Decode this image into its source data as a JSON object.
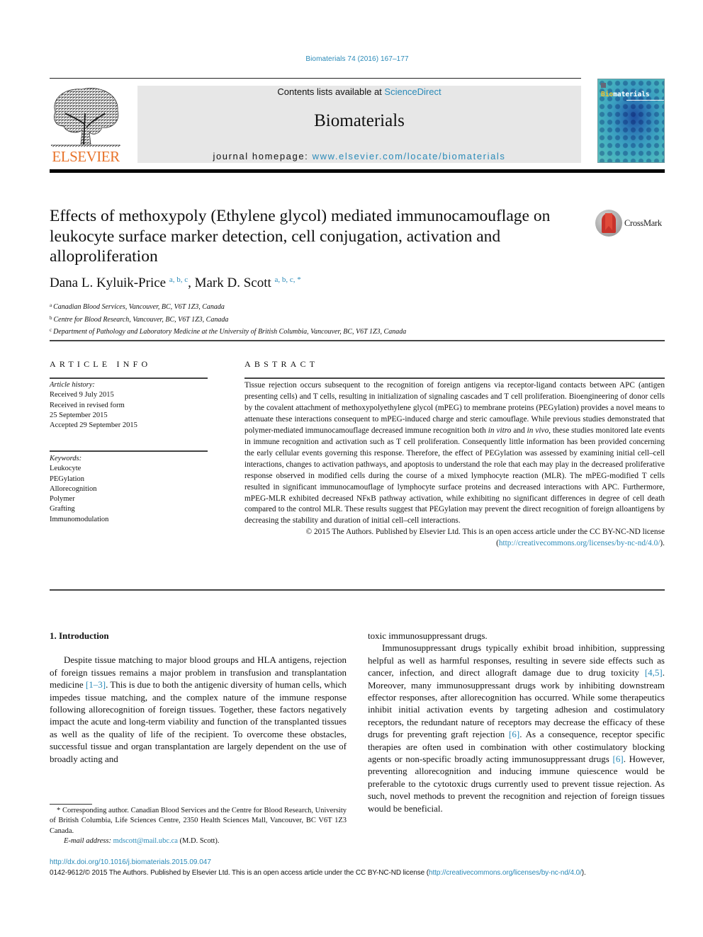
{
  "header": {
    "citation": "Biomaterials 74 (2016) 167–177",
    "contents_prefix": "Contents lists available at ",
    "contents_link": "ScienceDirect",
    "journal_name": "Biomaterials",
    "homepage_prefix": "journal homepage: ",
    "homepage_link": "www.elsevier.com/locate/biomaterials",
    "publisher_logo_text": "ELSEVIER",
    "cover_title_highlight": "Bio",
    "cover_title_rest": "materials"
  },
  "article": {
    "title": "Effects of methoxypoly (Ethylene glycol) mediated immunocamouflage on leukocyte surface marker detection, cell conjugation, activation and alloproliferation",
    "crossmark_label": "CrossMark",
    "authors": [
      {
        "name": "Dana L. Kyluik-Price",
        "affil_marks": "a, b, c",
        "separator": ", "
      },
      {
        "name": "Mark D. Scott",
        "affil_marks": "a, b, c, *",
        "separator": ""
      }
    ],
    "affiliations": [
      {
        "mark": "a",
        "text": "Canadian Blood Services, Vancouver, BC, V6T 1Z3, Canada"
      },
      {
        "mark": "b",
        "text": "Centre for Blood Research, Vancouver, BC, V6T 1Z3, Canada"
      },
      {
        "mark": "c",
        "text": "Department of Pathology and Laboratory Medicine at the University of British Columbia, Vancouver, BC, V6T 1Z3, Canada"
      }
    ]
  },
  "article_info": {
    "heading": "ARTICLE INFO",
    "history_label": "Article history:",
    "history": [
      "Received 9 July 2015",
      "Received in revised form",
      "25 September 2015",
      "Accepted 29 September 2015"
    ],
    "keywords_label": "Keywords:",
    "keywords": [
      "Leukocyte",
      "PEGylation",
      "Allorecognition",
      "Polymer",
      "Grafting",
      "Immunomodulation"
    ]
  },
  "abstract": {
    "heading": "ABSTRACT",
    "text_part1": "Tissue rejection occurs subsequent to the recognition of foreign antigens via receptor-ligand contacts between APC (antigen presenting cells) and T cells, resulting in initialization of signaling cascades and T cell proliferation. Bioengineering of donor cells by the covalent attachment of methoxypolyethylene glycol (mPEG) to membrane proteins (PEGylation) provides a novel means to attenuate these interactions consequent to mPEG-induced charge and steric camouflage. While previous studies demonstrated that polymer-mediated immunocamouflage decreased immune recognition both ",
    "italic1": "in vitro",
    "text_part2": " and ",
    "italic2": "in vivo",
    "text_part3": ", these studies monitored late events in immune recognition and activation such as T cell proliferation. Consequently little information has been provided concerning the early cellular events governing this response. Therefore, the effect of PEGylation was assessed by examining initial cell–cell interactions, changes to activation pathways, and apoptosis to understand the role that each may play in the decreased proliferative response observed in modified cells during the course of a mixed lymphocyte reaction (MLR). The mPEG-modified T cells resulted in significant immunocamouflage of lymphocyte surface proteins and decreased interactions with APC. Furthermore, mPEG-MLR exhibited decreased NFκB pathway activation, while exhibiting no significant differences in degree of cell death compared to the control MLR. These results suggest that PEGylation may prevent the direct recognition of foreign alloantigens by decreasing the stability and duration of initial cell–cell interactions.",
    "copyright_text": "© 2015 The Authors. Published by Elsevier Ltd. This is an open access article under the CC BY-NC-ND license (",
    "license_link": "http://creativecommons.org/licenses/by-nc-nd/4.0/",
    "copyright_close": ")."
  },
  "introduction": {
    "heading": "1.  Introduction",
    "p1_a": "Despite tissue matching to major blood groups and HLA antigens, rejection of foreign tissues remains a major problem in transfusion and transplantation medicine ",
    "p1_ref1": "[1–3]",
    "p1_b": ". This is due to both the antigenic diversity of human cells, which impedes tissue matching, and the complex nature of the immune response following allorecognition of foreign tissues. Together, these factors negatively impact the acute and long-term viability and function of the transplanted tissues as well as the quality of life of the recipient. To overcome these obstacles, successful tissue and organ transplantation are largely dependent on the use of broadly acting and toxic immunosuppressant drugs.",
    "p2_a": "Immunosuppressant drugs typically exhibit broad inhibition, suppressing helpful as well as harmful responses, resulting in severe side effects such as cancer, infection, and direct allograft damage due to drug toxicity ",
    "p2_ref1": "[4,5]",
    "p2_b": ". Moreover, many immunosuppressant drugs work by inhibiting downstream effector responses, after allorecognition has occurred. While some therapeutics inhibit initial activation events by targeting adhesion and costimulatory receptors, the redundant nature of receptors may decrease the efficacy of these drugs for preventing graft rejection ",
    "p2_ref2": "[6]",
    "p2_c": ". As a consequence, receptor specific therapies are often used in combination with other costimulatory blocking agents or non-specific broadly acting immunosuppressant drugs ",
    "p2_ref3": "[6]",
    "p2_d": ". However, preventing allorecognition and inducing immune quiescence would be preferable to the cytotoxic drugs currently used to prevent tissue rejection. As such, novel methods to prevent the recognition and rejection of foreign tissues would be beneficial."
  },
  "footnote": {
    "corresponding": "* Corresponding author. Canadian Blood Services and the Centre for Blood Research, University of British Columbia, Life Sciences Centre, 2350 Health Sciences Mall, Vancouver, BC V6T 1Z3 Canada.",
    "email_label": "E-mail address:",
    "email": "mdscott@mail.ubc.ca",
    "email_suffix": " (M.D. Scott)."
  },
  "footer": {
    "doi": "http://dx.doi.org/10.1016/j.biomaterials.2015.09.047",
    "issn_text": "0142-9612/© 2015 The Authors. Published by Elsevier Ltd. This is an open access article under the CC BY-NC-ND license (",
    "issn_link": "http://creativecommons.org/licenses/by-nc-nd/4.0/",
    "issn_close": ")."
  }
}
